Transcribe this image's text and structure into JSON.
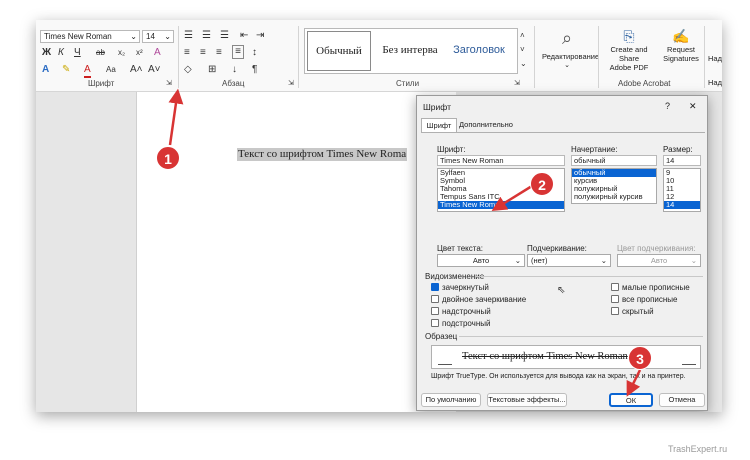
{
  "ribbon": {
    "font_name": "Times New Roman",
    "font_size": "14",
    "group_font": "Шрифт",
    "group_paragraph": "Абзац",
    "group_styles": "Стили",
    "style_normal": "Обычный",
    "style_no_spacing": "Без интерва",
    "style_heading": "Заголовок",
    "editing": "Редактирование",
    "create_share_pdf_1": "Create and Share",
    "create_share_pdf_2": "Adobe PDF",
    "request_signatures_1": "Request",
    "request_signatures_2": "Signatures",
    "adobe_group": "Adobe Acrobat",
    "more_right": "Над"
  },
  "document": {
    "text": "Текст со шрифтом Times New Roma"
  },
  "dialog": {
    "title": "Шрифт",
    "help": "?",
    "close": "✕",
    "tabs": [
      "Шрифт",
      "Дополнительно"
    ],
    "font_label": "Шрифт:",
    "font_value": "Times New Roman",
    "fonts": [
      "Sylfaen",
      "Symbol",
      "Tahoma",
      "Tempus Sans ITC",
      "Times New Roman"
    ],
    "style_label": "Начертание:",
    "style_value": "обычный",
    "styles": [
      "обычный",
      "курсив",
      "полужирный",
      "полужирный курсив"
    ],
    "size_label": "Размер:",
    "size_value": "14",
    "sizes": [
      "9",
      "10",
      "11",
      "12",
      "14"
    ],
    "text_color_label": "Цвет текста:",
    "text_color_value": "Авто",
    "underline_label": "Подчеркивание:",
    "underline_value": "(нет)",
    "underline_color_label": "Цвет подчеркивания:",
    "underline_color_value": "Авто",
    "effects_label": "Видоизменение",
    "effects_left": [
      {
        "label": "зачеркнутый",
        "checked": true
      },
      {
        "label": "двойное зачеркивание",
        "checked": false
      },
      {
        "label": "надстрочный",
        "checked": false
      },
      {
        "label": "подстрочный",
        "checked": false
      }
    ],
    "effects_right": [
      {
        "label": "малые прописные",
        "checked": false
      },
      {
        "label": "все прописные",
        "checked": false
      },
      {
        "label": "скрытый",
        "checked": false
      }
    ],
    "preview_label": "Образец",
    "preview_text": "Текст со шрифтом Times New Roman",
    "preview_note": "Шрифт TrueType. Он используется для вывода как на экран, так и на принтер.",
    "default_button": "По умолчанию",
    "text_effects_button": "Текстовые эффекты...",
    "ok_button": "ОК",
    "cancel_button": "Отмена"
  },
  "annotations": [
    "1",
    "2",
    "3"
  ],
  "watermark": "TrashExpert.ru",
  "colors": {
    "highlight": "#0a64d2",
    "annotation": "#d83434"
  }
}
